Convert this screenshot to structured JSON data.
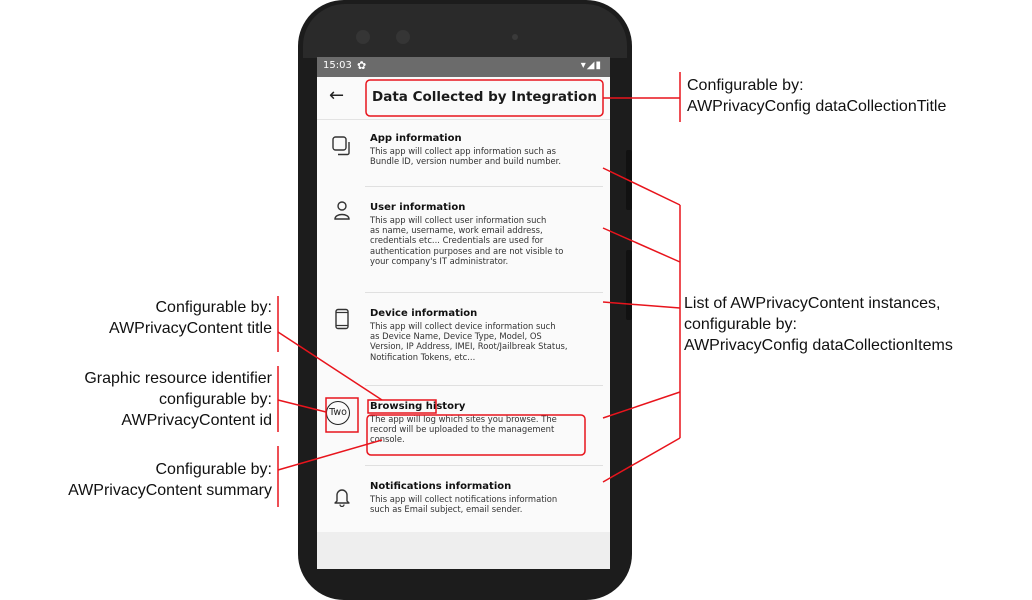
{
  "status_bar": {
    "time": "15:03",
    "settings_icon": "gear-icon",
    "signal_icons": "▾◢▮"
  },
  "app_bar": {
    "back_icon": "arrow-left-icon",
    "title": "Data Collected by Integration Gui..."
  },
  "items": [
    {
      "icon": "app-window-icon",
      "title": "App information",
      "summary": [
        "This app will collect app information such as",
        "Bundle ID, version number and build number."
      ]
    },
    {
      "icon": "person-icon",
      "title": "User information",
      "summary": [
        "This app will collect user information such",
        "as name, username, work email address,",
        "credentials etc... Credentials are used for",
        "authentication purposes and are not visible to",
        "your company's IT administrator."
      ]
    },
    {
      "icon": "phone-device-icon",
      "title": "Device information",
      "summary": [
        "This app will collect device information such",
        "as Device Name, Device Type, Model, OS",
        "Version, IP Address, IMEI, Root/Jailbreak Status,",
        "Notification Tokens, etc..."
      ]
    },
    {
      "icon_text": "Two",
      "title": "Browsing history",
      "summary": [
        "The app will log which sites you browse. The",
        "record will be uploaded to the management",
        "console."
      ]
    },
    {
      "icon": "bell-icon",
      "title": "Notifications information",
      "summary": [
        "This app will collect notifications information",
        "such as Email subject, email sender."
      ]
    }
  ],
  "annotations": {
    "title_config": [
      "Configurable by:",
      "AWPrivacyConfig dataCollectionTitle"
    ],
    "list_config": [
      "List of AWPrivacyContent instances,",
      "configurable by:",
      "AWPrivacyConfig dataCollectionItems"
    ],
    "content_title": [
      "Configurable by:",
      "AWPrivacyContent title"
    ],
    "content_id": [
      "Graphic resource identifier",
      "configurable by:",
      "AWPrivacyContent id"
    ],
    "content_summary": [
      "Configurable by:",
      "AWPrivacyContent summary"
    ]
  },
  "colors": {
    "annotation_red": "#e8141c",
    "phone_body": "#1c1c1c",
    "status_bar": "#6b6b6b"
  }
}
